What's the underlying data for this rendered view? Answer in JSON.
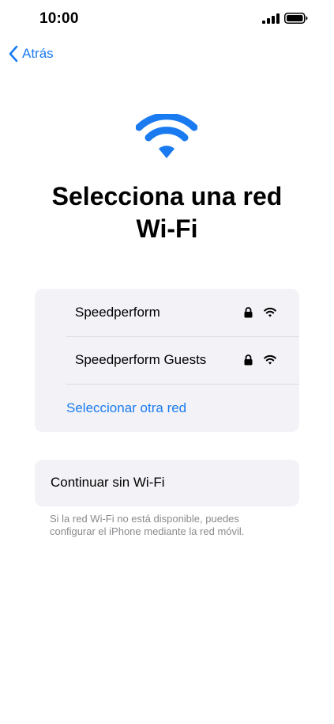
{
  "status_bar": {
    "time": "10:00",
    "icons": [
      "signal-icon",
      "battery-icon"
    ]
  },
  "nav": {
    "back_label": "Atrás"
  },
  "header": {
    "icon": "wifi-icon",
    "title_line1": "Selecciona una red",
    "title_line2": "Wi-Fi"
  },
  "networks": [
    {
      "name": "Speedperform",
      "locked": true,
      "icon": "wifi-icon"
    },
    {
      "name": "Speedperform Guests",
      "locked": true,
      "icon": "wifi-icon"
    }
  ],
  "other_network_label": "Seleccionar otra red",
  "continue_label": "Continuar sin Wi-Fi",
  "footnote": "Si la red Wi-Fi no está disponible, puedes configurar el iPhone mediante la red móvil.",
  "colors": {
    "accent": "#1a7bf1",
    "group_bg": "#f2f2f7",
    "secondary_text": "#8a8a8e"
  }
}
